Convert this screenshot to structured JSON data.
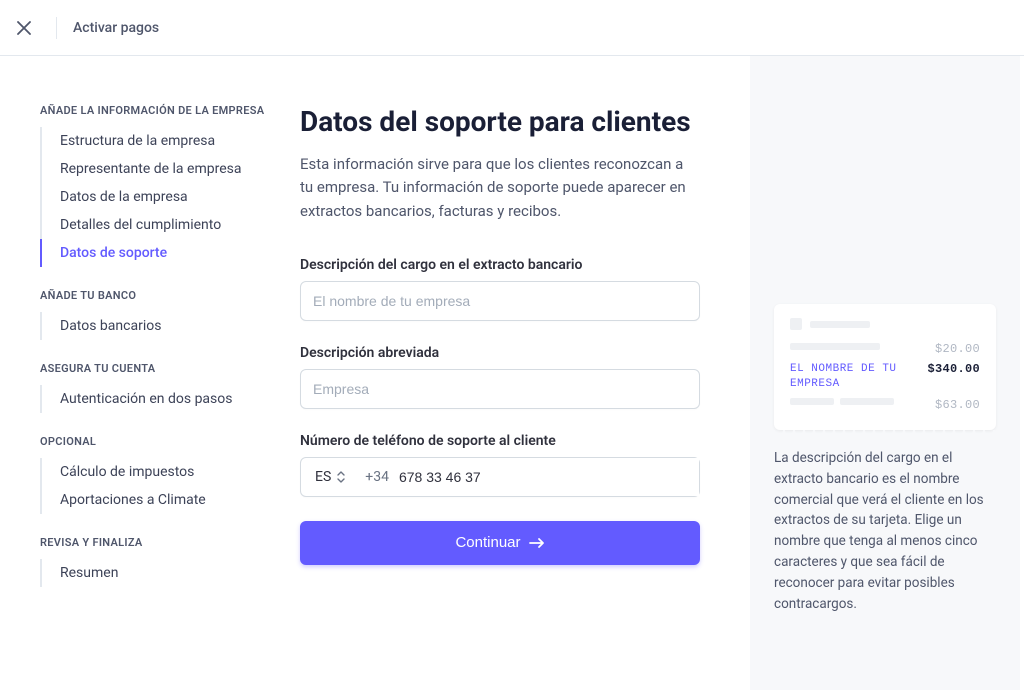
{
  "topbar": {
    "title": "Activar pagos"
  },
  "sidebar": {
    "sections": [
      {
        "title": "AÑADE LA INFORMACIÓN DE LA EMPRESA",
        "items": [
          {
            "label": "Estructura de la empresa"
          },
          {
            "label": "Representante de la empresa"
          },
          {
            "label": "Datos de la empresa"
          },
          {
            "label": "Detalles del cumplimiento"
          },
          {
            "label": "Datos de soporte",
            "active": true
          }
        ]
      },
      {
        "title": "AÑADE TU BANCO",
        "items": [
          {
            "label": "Datos bancarios"
          }
        ]
      },
      {
        "title": "ASEGURA TU CUENTA",
        "items": [
          {
            "label": "Autenticación en dos pasos"
          }
        ]
      },
      {
        "title": "OPCIONAL",
        "items": [
          {
            "label": "Cálculo de impuestos"
          },
          {
            "label": "Aportaciones a Climate"
          }
        ]
      },
      {
        "title": "REVISA Y FINALIZA",
        "items": [
          {
            "label": "Resumen"
          }
        ]
      }
    ]
  },
  "main": {
    "heading": "Datos del soporte para clientes",
    "lead": "Esta información sirve para que los clientes reconozcan a tu empresa. Tu información de soporte puede aparecer en extractos bancarios, facturas y recibos.",
    "fields": {
      "statement": {
        "label": "Descripción del cargo en el extracto bancario",
        "placeholder": "El nombre de tu empresa",
        "value": ""
      },
      "short": {
        "label": "Descripción abreviada",
        "placeholder": "Empresa",
        "value": ""
      },
      "phone": {
        "label": "Número de teléfono de soporte al cliente",
        "country": "ES",
        "prefix": "+34",
        "value": "678 33 46 37"
      }
    },
    "cta": "Continuar"
  },
  "aside": {
    "receipt": {
      "merchant": "EL NOMBRE DE TU EMPRESA",
      "amounts": [
        "$20.00",
        "$340.00",
        "$63.00"
      ]
    },
    "help": "La descripción del cargo en el extracto bancario es el nombre comercial que verá el cliente en los extractos de su tarjeta. Elige un nombre que tenga al menos cinco caracteres y que sea fácil de reconocer para evitar posibles contracargos."
  }
}
